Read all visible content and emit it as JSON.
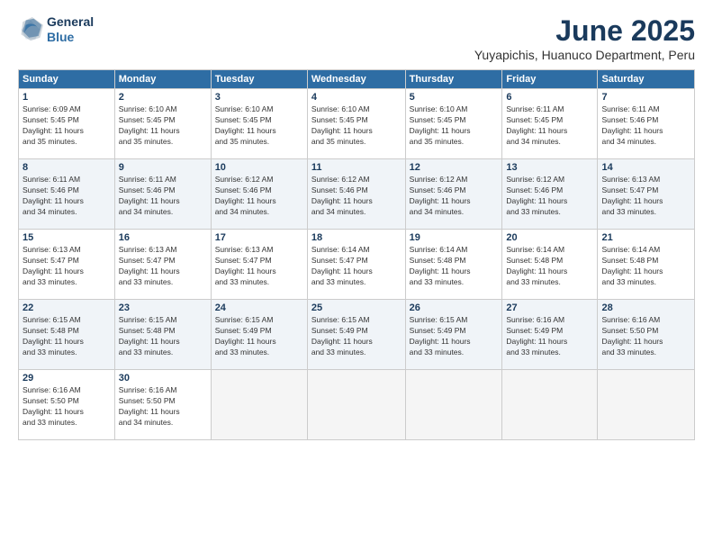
{
  "header": {
    "logo_line1": "General",
    "logo_line2": "Blue",
    "month": "June 2025",
    "location": "Yuyapichis, Huanuco Department, Peru"
  },
  "weekdays": [
    "Sunday",
    "Monday",
    "Tuesday",
    "Wednesday",
    "Thursday",
    "Friday",
    "Saturday"
  ],
  "weeks": [
    [
      {
        "day": "1",
        "info": "Sunrise: 6:09 AM\nSunset: 5:45 PM\nDaylight: 11 hours\nand 35 minutes."
      },
      {
        "day": "2",
        "info": "Sunrise: 6:10 AM\nSunset: 5:45 PM\nDaylight: 11 hours\nand 35 minutes."
      },
      {
        "day": "3",
        "info": "Sunrise: 6:10 AM\nSunset: 5:45 PM\nDaylight: 11 hours\nand 35 minutes."
      },
      {
        "day": "4",
        "info": "Sunrise: 6:10 AM\nSunset: 5:45 PM\nDaylight: 11 hours\nand 35 minutes."
      },
      {
        "day": "5",
        "info": "Sunrise: 6:10 AM\nSunset: 5:45 PM\nDaylight: 11 hours\nand 35 minutes."
      },
      {
        "day": "6",
        "info": "Sunrise: 6:11 AM\nSunset: 5:45 PM\nDaylight: 11 hours\nand 34 minutes."
      },
      {
        "day": "7",
        "info": "Sunrise: 6:11 AM\nSunset: 5:46 PM\nDaylight: 11 hours\nand 34 minutes."
      }
    ],
    [
      {
        "day": "8",
        "info": "Sunrise: 6:11 AM\nSunset: 5:46 PM\nDaylight: 11 hours\nand 34 minutes."
      },
      {
        "day": "9",
        "info": "Sunrise: 6:11 AM\nSunset: 5:46 PM\nDaylight: 11 hours\nand 34 minutes."
      },
      {
        "day": "10",
        "info": "Sunrise: 6:12 AM\nSunset: 5:46 PM\nDaylight: 11 hours\nand 34 minutes."
      },
      {
        "day": "11",
        "info": "Sunrise: 6:12 AM\nSunset: 5:46 PM\nDaylight: 11 hours\nand 34 minutes."
      },
      {
        "day": "12",
        "info": "Sunrise: 6:12 AM\nSunset: 5:46 PM\nDaylight: 11 hours\nand 34 minutes."
      },
      {
        "day": "13",
        "info": "Sunrise: 6:12 AM\nSunset: 5:46 PM\nDaylight: 11 hours\nand 33 minutes."
      },
      {
        "day": "14",
        "info": "Sunrise: 6:13 AM\nSunset: 5:47 PM\nDaylight: 11 hours\nand 33 minutes."
      }
    ],
    [
      {
        "day": "15",
        "info": "Sunrise: 6:13 AM\nSunset: 5:47 PM\nDaylight: 11 hours\nand 33 minutes."
      },
      {
        "day": "16",
        "info": "Sunrise: 6:13 AM\nSunset: 5:47 PM\nDaylight: 11 hours\nand 33 minutes."
      },
      {
        "day": "17",
        "info": "Sunrise: 6:13 AM\nSunset: 5:47 PM\nDaylight: 11 hours\nand 33 minutes."
      },
      {
        "day": "18",
        "info": "Sunrise: 6:14 AM\nSunset: 5:47 PM\nDaylight: 11 hours\nand 33 minutes."
      },
      {
        "day": "19",
        "info": "Sunrise: 6:14 AM\nSunset: 5:48 PM\nDaylight: 11 hours\nand 33 minutes."
      },
      {
        "day": "20",
        "info": "Sunrise: 6:14 AM\nSunset: 5:48 PM\nDaylight: 11 hours\nand 33 minutes."
      },
      {
        "day": "21",
        "info": "Sunrise: 6:14 AM\nSunset: 5:48 PM\nDaylight: 11 hours\nand 33 minutes."
      }
    ],
    [
      {
        "day": "22",
        "info": "Sunrise: 6:15 AM\nSunset: 5:48 PM\nDaylight: 11 hours\nand 33 minutes."
      },
      {
        "day": "23",
        "info": "Sunrise: 6:15 AM\nSunset: 5:48 PM\nDaylight: 11 hours\nand 33 minutes."
      },
      {
        "day": "24",
        "info": "Sunrise: 6:15 AM\nSunset: 5:49 PM\nDaylight: 11 hours\nand 33 minutes."
      },
      {
        "day": "25",
        "info": "Sunrise: 6:15 AM\nSunset: 5:49 PM\nDaylight: 11 hours\nand 33 minutes."
      },
      {
        "day": "26",
        "info": "Sunrise: 6:15 AM\nSunset: 5:49 PM\nDaylight: 11 hours\nand 33 minutes."
      },
      {
        "day": "27",
        "info": "Sunrise: 6:16 AM\nSunset: 5:49 PM\nDaylight: 11 hours\nand 33 minutes."
      },
      {
        "day": "28",
        "info": "Sunrise: 6:16 AM\nSunset: 5:50 PM\nDaylight: 11 hours\nand 33 minutes."
      }
    ],
    [
      {
        "day": "29",
        "info": "Sunrise: 6:16 AM\nSunset: 5:50 PM\nDaylight: 11 hours\nand 33 minutes."
      },
      {
        "day": "30",
        "info": "Sunrise: 6:16 AM\nSunset: 5:50 PM\nDaylight: 11 hours\nand 34 minutes."
      },
      {
        "day": "",
        "info": ""
      },
      {
        "day": "",
        "info": ""
      },
      {
        "day": "",
        "info": ""
      },
      {
        "day": "",
        "info": ""
      },
      {
        "day": "",
        "info": ""
      }
    ]
  ]
}
